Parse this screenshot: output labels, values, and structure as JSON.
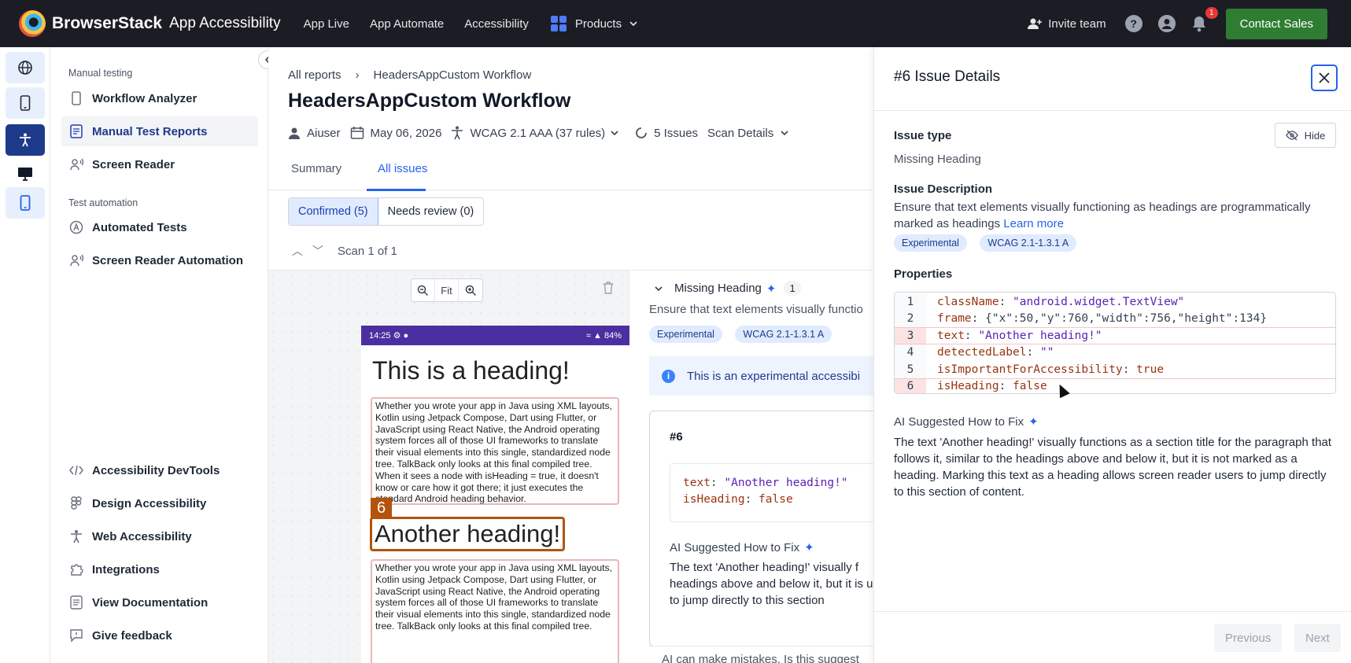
{
  "topbar": {
    "brand": "BrowserStack",
    "product": "App Accessibility",
    "nav": [
      "App Live",
      "App Automate",
      "Accessibility"
    ],
    "products_label": "Products",
    "invite_label": "Invite team",
    "notification_count": "1",
    "contact_label": "Contact Sales"
  },
  "rail": {
    "icons": [
      "globe-icon",
      "mobile-icon",
      "accessibility-icon",
      "desktop-icon",
      "mobile-app-icon"
    ]
  },
  "sidebar": {
    "manual_heading": "Manual testing",
    "manual_items": [
      "Workflow Analyzer",
      "Manual Test Reports",
      "Screen Reader"
    ],
    "auto_heading": "Test automation",
    "auto_items": [
      "Automated Tests",
      "Screen Reader Automation"
    ],
    "bottom_items": [
      "Accessibility DevTools",
      "Design Accessibility",
      "Web Accessibility",
      "Integrations",
      "View Documentation",
      "Give feedback"
    ]
  },
  "main": {
    "breadcrumb_root": "All reports",
    "breadcrumb_current": "HeadersAppCustom Workflow",
    "title": "HeadersAppCustom Workflow",
    "user": "Aiuser",
    "date": "May 06, 2026",
    "standard": "WCAG 2.1 AAA (37 rules)",
    "issues": "5 Issues",
    "scan_details": "Scan Details",
    "tabs": [
      "Summary",
      "All issues"
    ],
    "confirmed": "Confirmed (5)",
    "needs_review": "Needs review (0)",
    "scan_label": "Scan 1 of 1",
    "fit": "Fit"
  },
  "phone": {
    "time": "14:25",
    "battery": "84%",
    "heading1": "This is a heading!",
    "para": "Whether you wrote your app in Java using XML layouts, Kotlin using Jetpack Compose, Dart using Flutter, or JavaScript using React Native, the Android operating system forces all of those UI frameworks to translate their visual elements into this single, standardized node tree. TalkBack only looks at this final compiled tree. When it sees a node with isHeading = true, it doesn't know or care how it got there; it just executes the standard Android heading behavior.",
    "badge": "6",
    "heading2": "Another heading!",
    "para2": "Whether you wrote your app in Java using XML layouts, Kotlin using Jetpack Compose, Dart using Flutter, or JavaScript using React Native, the Android operating system forces all of those UI frameworks to translate their visual elements into this single, standardized node tree. TalkBack only looks at this final compiled tree."
  },
  "issue_panel": {
    "title": "Missing Heading",
    "count": "1",
    "desc": "Ensure that text elements visually functio",
    "pills": [
      "Experimental",
      "WCAG 2.1-1.3.1 A"
    ],
    "info": "This is an experimental accessibi",
    "number": "#6",
    "code_line1_key": "text",
    "code_line1_val": "\"Another heading!\"",
    "code_line2_key": "isHeading",
    "code_line2_val": "false",
    "ai_label": "AI Suggested How to Fix",
    "ai_text": "The text 'Another heading!' visually f headings above and below it, but it is users to jump directly to this section",
    "footer": "AI can make mistakes. Is this suggest"
  },
  "drawer": {
    "title": "#6 Issue Details",
    "hide_label": "Hide",
    "issue_type_label": "Issue type",
    "issue_type": "Missing Heading",
    "desc_label": "Issue Description",
    "desc": "Ensure that text elements visually functioning as headings are programmatically marked as headings",
    "learn_more": "Learn more",
    "pills": [
      "Experimental",
      "WCAG 2.1-1.3.1 A"
    ],
    "properties_label": "Properties",
    "properties": [
      {
        "n": "1",
        "key": "className",
        "val": "\"android.widget.TextView\""
      },
      {
        "n": "2",
        "key": "frame",
        "val": "{\"x\":50,\"y\":760,\"width\":756,\"height\":134}"
      },
      {
        "n": "3",
        "key": "text",
        "val": "\"Another heading!\""
      },
      {
        "n": "4",
        "key": "detectedLabel",
        "val": "\"\""
      },
      {
        "n": "5",
        "key": "isImportantForAccessibility",
        "val": "true"
      },
      {
        "n": "6",
        "key": "isHeading",
        "val": "false"
      }
    ],
    "ai_label": "AI Suggested How to Fix",
    "ai_text": "The text 'Another heading!' visually functions as a section title for the paragraph that follows it, similar to the headings above and below it, but it is not marked as a heading. Marking this text as a heading allows screen reader users to jump directly to this section of content.",
    "previous": "Previous",
    "next": "Next"
  },
  "colors": {
    "topbar": "#1c1c24",
    "accent": "#2563eb",
    "contact": "#2e7d32",
    "statusbar": "#4b2fa0",
    "highlight": "#b45309"
  }
}
